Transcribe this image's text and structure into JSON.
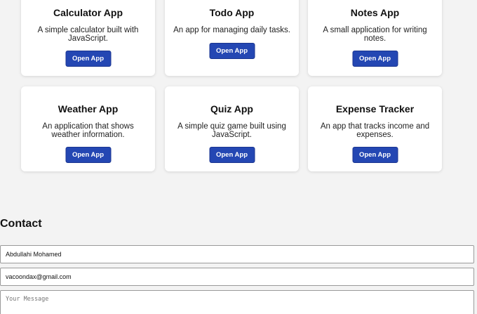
{
  "apps": [
    {
      "title": "Calculator App",
      "description": "A simple calculator built with JavaScript.",
      "button": "Open App"
    },
    {
      "title": "Todo App",
      "description": "An app for managing daily tasks.",
      "button": "Open App"
    },
    {
      "title": "Notes App",
      "description": "A small application for writing notes.",
      "button": "Open App"
    },
    {
      "title": "Weather App",
      "description": "An application that shows weather information.",
      "button": "Open App"
    },
    {
      "title": "Quiz App",
      "description": "A simple quiz game built using JavaScript.",
      "button": "Open App"
    },
    {
      "title": "Expense Tracker",
      "description": "An app that tracks income and expenses.",
      "button": "Open App"
    }
  ],
  "contact": {
    "heading": "Contact",
    "name_value": "Abdullahi Mohamed",
    "email_value": "vacoondax@gmail.com",
    "message_placeholder": "Your Message"
  },
  "colors": {
    "button": "#2447b3",
    "background": "#f3f3f3"
  }
}
